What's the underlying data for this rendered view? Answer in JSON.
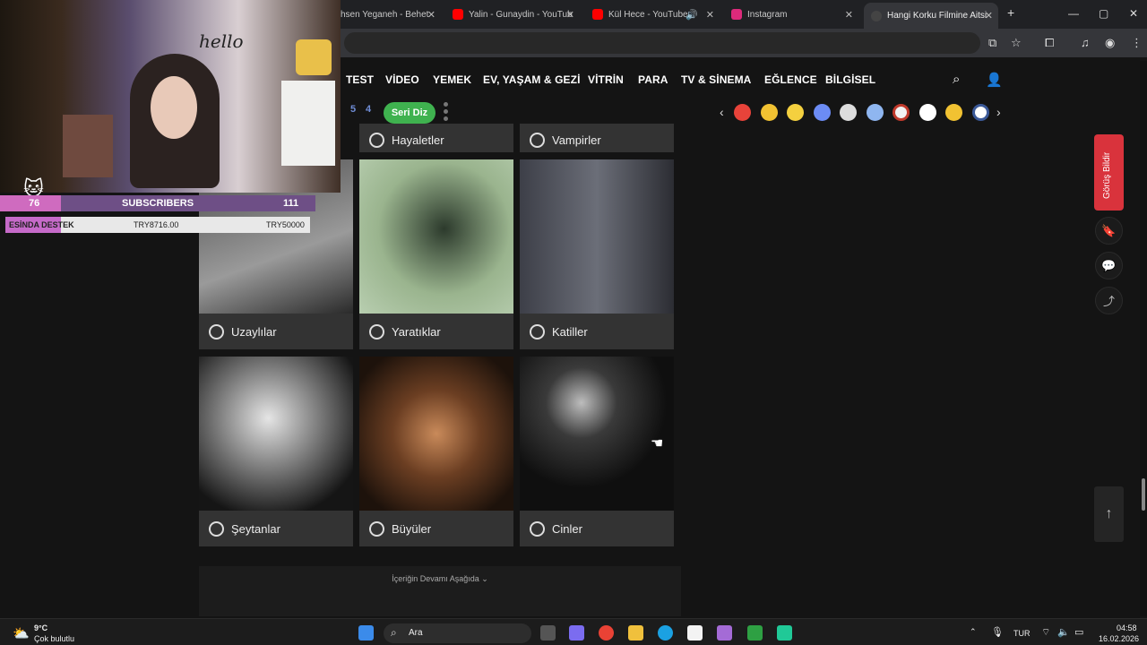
{
  "browser": {
    "tabs": [
      {
        "title": "hsen Yeganeh - Behet",
        "icon_color": "#555555"
      },
      {
        "title": "Yalin - Gunaydin - YouTub",
        "icon_color": "#ff0000"
      },
      {
        "title": "Kül Hece - YouTube",
        "icon_color": "#ff0000"
      },
      {
        "title": "Instagram",
        "icon_color": "#dd2a7b"
      },
      {
        "title": "Hangi Korku Filmine Aitsi",
        "icon_color": "#333333"
      }
    ],
    "new_tab": "+",
    "window_controls": [
      "—",
      "▢",
      "✕"
    ]
  },
  "site": {
    "nav": [
      "TEST",
      "VİDEO",
      "YEMEK",
      "EV, YAŞAM & GEZİ",
      "VİTRİN",
      "PARA",
      "TV & SİNEMA",
      "EĞLENCE",
      "BİLGİSEL"
    ],
    "seri_numbers": [
      "5",
      "4"
    ],
    "seri_button": "Seri Diz",
    "reaction_colors": [
      "#e8433a",
      "#f1c232",
      "#f4d03f",
      "#6c8cf5",
      "#dddddd",
      "#8fb6f0",
      "#f2f2f2",
      "#ffffff",
      "#f1c232",
      "#ffffff"
    ]
  },
  "quiz": {
    "top_row": [
      "Hayaletler",
      "Vampirler"
    ],
    "options": [
      "Uzaylılar",
      "Yaratıklar",
      "Katiller",
      "Şeytanlar",
      "Büyüler",
      "Cinler"
    ],
    "more_label": "İçeriğin Devamı Aşağıda ⌄"
  },
  "side": {
    "feedback_label": "Görüş Bildir"
  },
  "stream": {
    "subscriber_count_left": "76",
    "subscriber_label": "SUBSCRIBERS",
    "subscriber_goal": "111",
    "donation_label": "ESİNDA DESTEK",
    "donation_current": "TRY8716.00",
    "donation_goal": "TRY50000",
    "cam_text": "hello"
  },
  "taskbar": {
    "weather_temp": "9°C",
    "weather_desc": "Çok bulutlu",
    "search_placeholder": "Ara",
    "language": "TUR",
    "time": "04:58",
    "date": "16.02.2026"
  }
}
